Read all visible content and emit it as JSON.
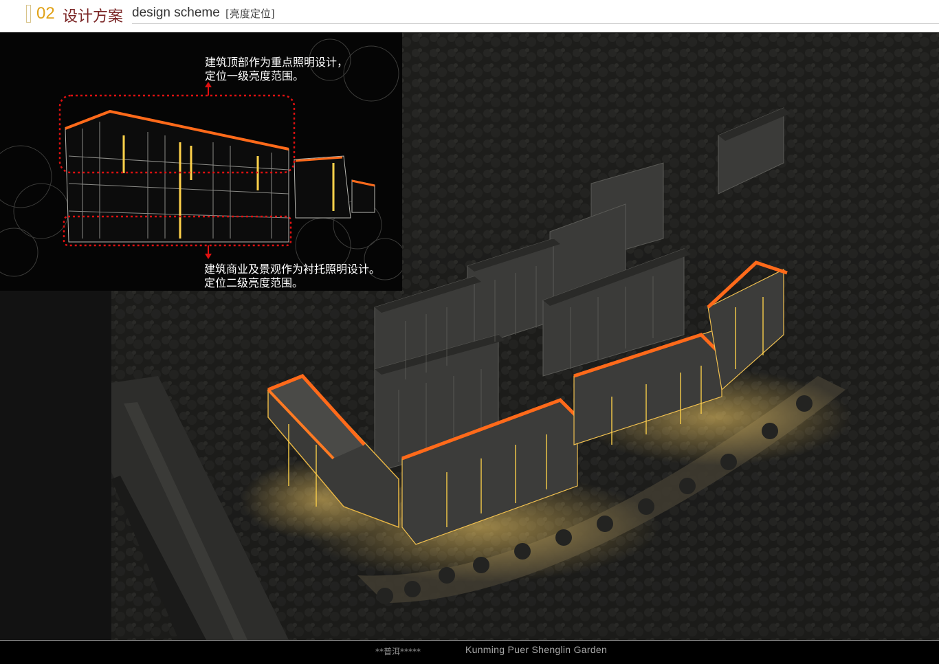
{
  "header": {
    "section_number": "02",
    "section_title": "设计方案",
    "section_title_en": "design scheme",
    "section_tag": "[亮度定位]"
  },
  "inset": {
    "callout_top_line1": "建筑顶部作为重点照明设计，",
    "callout_top_line2": "定位一级亮度范围。",
    "callout_bottom_line1": "建筑商业及景观作为衬托照明设计。",
    "callout_bottom_line2": "定位二级亮度范围。"
  },
  "footer": {
    "project_cn": "**普洱*****",
    "project_en": "Kunming Puer Shenglin Garden"
  },
  "colors": {
    "accent_gold": "#e0a116",
    "title_red": "#7a2424",
    "roof_orange": "#ff6a1a",
    "highlight_red_dotted": "#e01010",
    "facade_yellow": "#ffd24a"
  }
}
